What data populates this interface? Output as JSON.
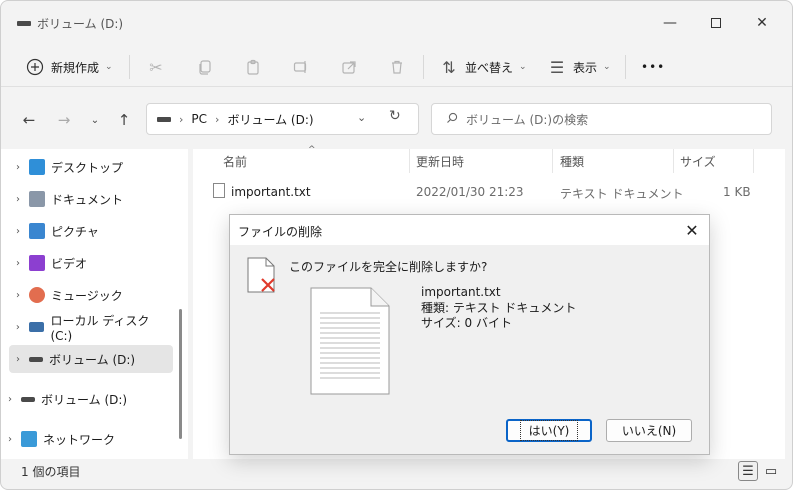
{
  "window": {
    "title": "ボリューム (D:)",
    "minimize_glyph": "—",
    "close_glyph": "✕"
  },
  "commands": {
    "new_label": "新規作成",
    "sort_label": "並べ替え",
    "view_label": "表示",
    "more_glyph": "•••"
  },
  "address": {
    "root": "PC",
    "current": "ボリューム (D:)",
    "search_placeholder": "ボリューム (D:)の検索"
  },
  "sidebar": {
    "items": [
      {
        "label": "デスクトップ",
        "icon": "desktop-icon"
      },
      {
        "label": "ドキュメント",
        "icon": "documents-icon"
      },
      {
        "label": "ピクチャ",
        "icon": "pictures-icon"
      },
      {
        "label": "ビデオ",
        "icon": "videos-icon"
      },
      {
        "label": "ミュージック",
        "icon": "music-icon"
      },
      {
        "label": "ローカル ディスク (C:)",
        "icon": "local-disk-icon"
      },
      {
        "label": "ボリューム (D:)",
        "icon": "drive-icon",
        "selected": true
      },
      {
        "label": "ボリューム (D:)",
        "icon": "drive-icon"
      },
      {
        "label": "ネットワーク",
        "icon": "network-icon"
      }
    ]
  },
  "columns": {
    "name": "名前",
    "modified": "更新日時",
    "type": "種類",
    "size": "サイズ"
  },
  "files": [
    {
      "name": "important.txt",
      "modified": "2022/01/30 21:23",
      "type": "テキスト ドキュメント",
      "size": "1 KB"
    }
  ],
  "status": {
    "count_text": "1 個の項目"
  },
  "dialog": {
    "title": "ファイルの削除",
    "question": "このファイルを完全に削除しますか?",
    "file_name": "important.txt",
    "file_type": "種類: テキスト ドキュメント",
    "file_size": "サイズ: 0 バイト",
    "yes_label": "はい(Y)",
    "no_label": "いいえ(N)",
    "close_glyph": "✕"
  }
}
